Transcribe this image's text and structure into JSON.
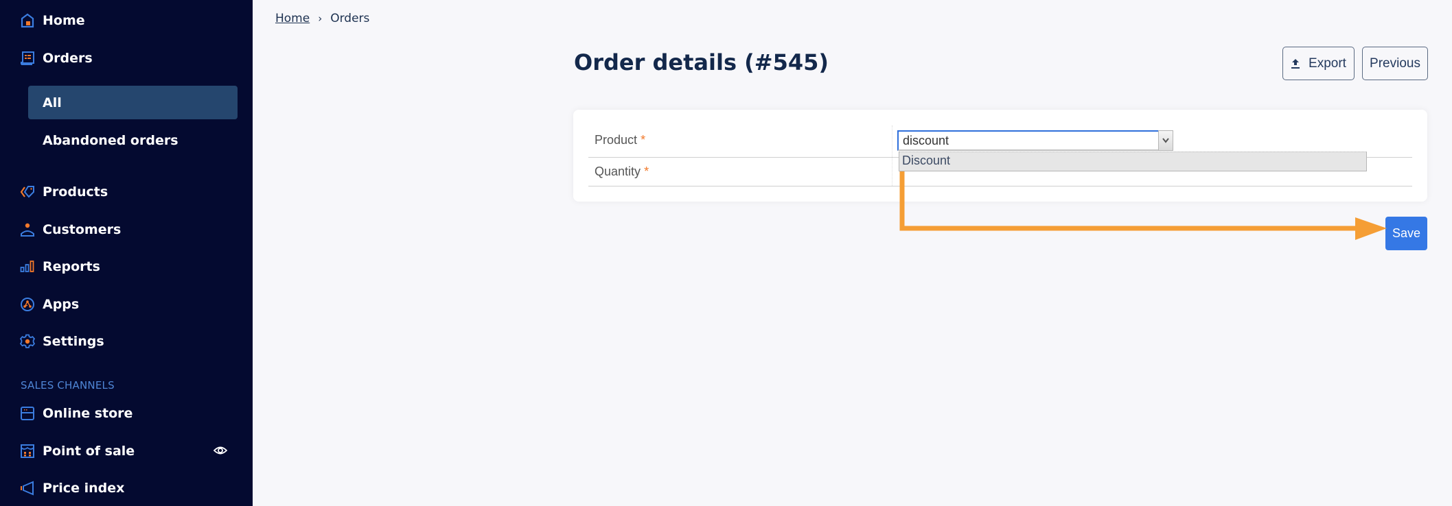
{
  "sidebar": {
    "items": [
      {
        "label": "Home",
        "icon": "home-icon"
      },
      {
        "label": "Orders",
        "icon": "orders-icon"
      },
      {
        "label": "Products",
        "icon": "tag-icon"
      },
      {
        "label": "Customers",
        "icon": "person-icon"
      },
      {
        "label": "Reports",
        "icon": "bar-chart-icon"
      },
      {
        "label": "Apps",
        "icon": "apps-icon"
      },
      {
        "label": "Settings",
        "icon": "gear-icon"
      }
    ],
    "order_subitems": [
      {
        "label": "All",
        "active": true
      },
      {
        "label": "Abandoned orders",
        "active": false
      }
    ],
    "section_label": "SALES CHANNELS",
    "channels": [
      {
        "label": "Online store",
        "icon": "store-icon"
      },
      {
        "label": "Point of sale",
        "icon": "pos-icon",
        "trailing_icon": "eye-icon"
      },
      {
        "label": "Price index",
        "icon": "megaphone-icon"
      }
    ]
  },
  "breadcrumb": {
    "items": [
      "Home",
      "Orders"
    ],
    "separator": "›"
  },
  "header": {
    "title": "Order details (#545)",
    "export_label": "Export",
    "previous_label": "Previous"
  },
  "form": {
    "fields": [
      {
        "label": "Product",
        "required_marker": "*"
      },
      {
        "label": "Quantity",
        "required_marker": "*"
      }
    ],
    "product_input_value": "discount",
    "dropdown_options": [
      "Discount"
    ]
  },
  "actions": {
    "save_label": "Save"
  },
  "colors": {
    "sidebar_bg": "#040a30",
    "active_item_bg": "#25466e",
    "accent_blue": "#3578e5",
    "icon_orange": "#f2792b",
    "annotation_arrow": "#f59e35"
  }
}
